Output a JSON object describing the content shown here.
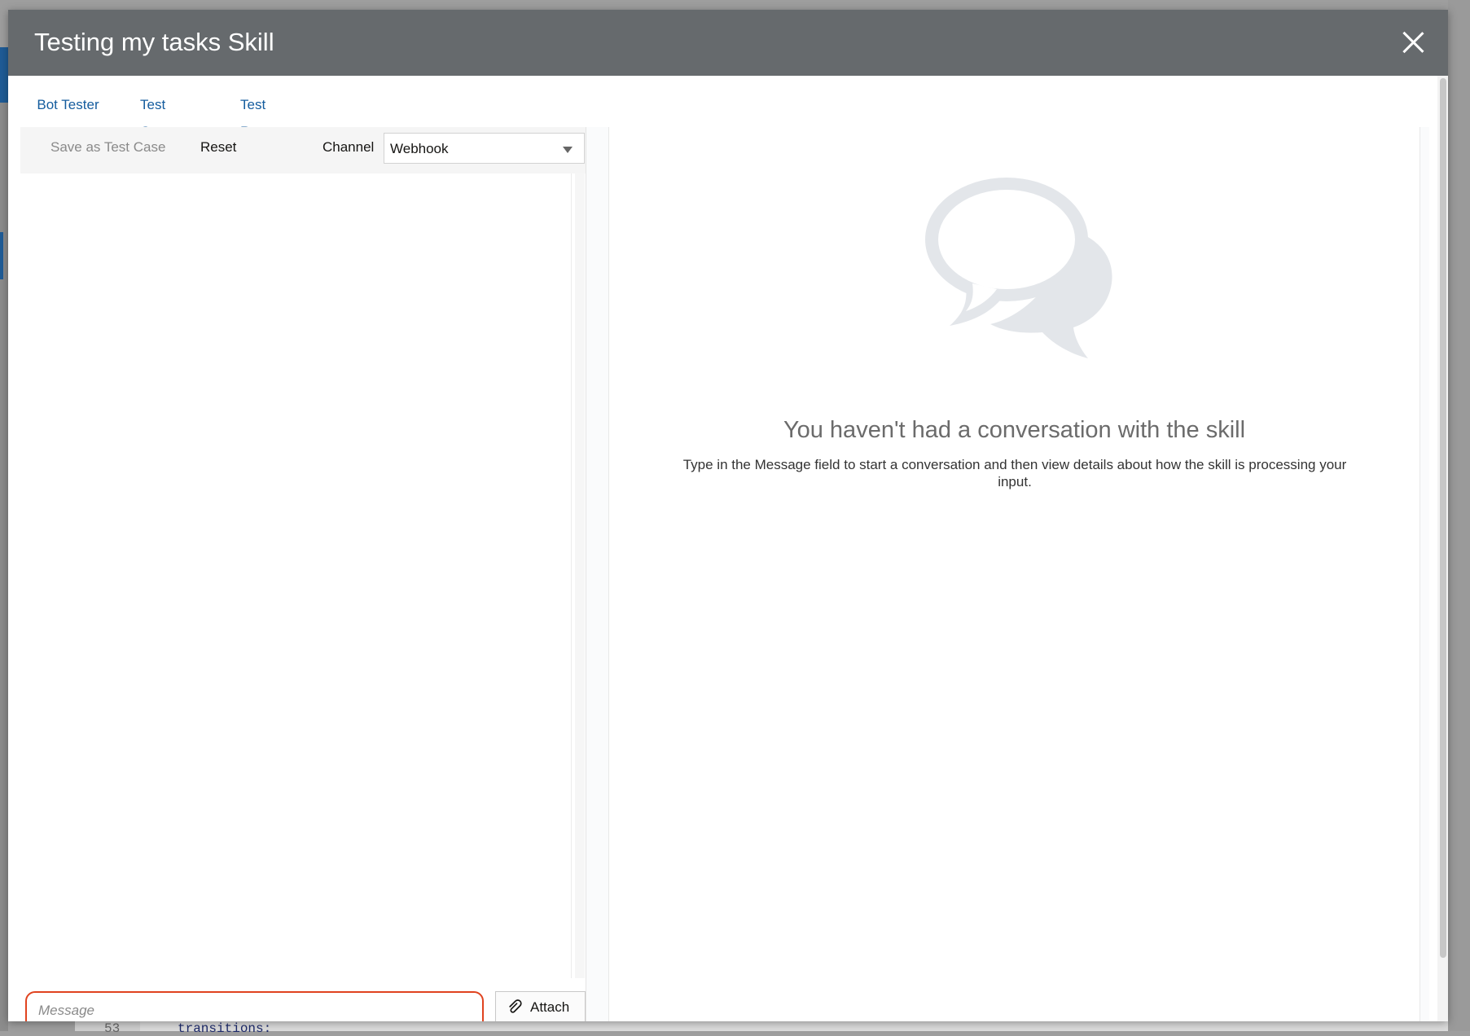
{
  "dialog": {
    "title": "Testing my tasks Skill",
    "close_icon": "close-icon"
  },
  "tabs": [
    {
      "label": "Bot Tester",
      "active": true
    },
    {
      "label": "Test Cases",
      "active": false
    },
    {
      "label": "Test Run Results",
      "active": false
    }
  ],
  "toolbar": {
    "save_as_test_case": "Save as Test Case",
    "reset": "Reset",
    "channel_label": "Channel",
    "channel_value": "Webhook"
  },
  "composer": {
    "message_placeholder": "Message",
    "attach_label": "Attach",
    "attach_icon": "paperclip-icon"
  },
  "empty_state": {
    "icon": "chat-bubbles-icon",
    "title": "You haven't had a conversation with the skill",
    "description": "Type in the Message field to start a conversation and then view details about how the skill is processing your input."
  },
  "background_editor": {
    "line_number": "53",
    "line_text": "transitions:"
  },
  "colors": {
    "header_bg": "#666a6d",
    "tab_accent": "#1f67a8",
    "input_highlight": "#e0431f",
    "background_band": "#1f5c97"
  }
}
